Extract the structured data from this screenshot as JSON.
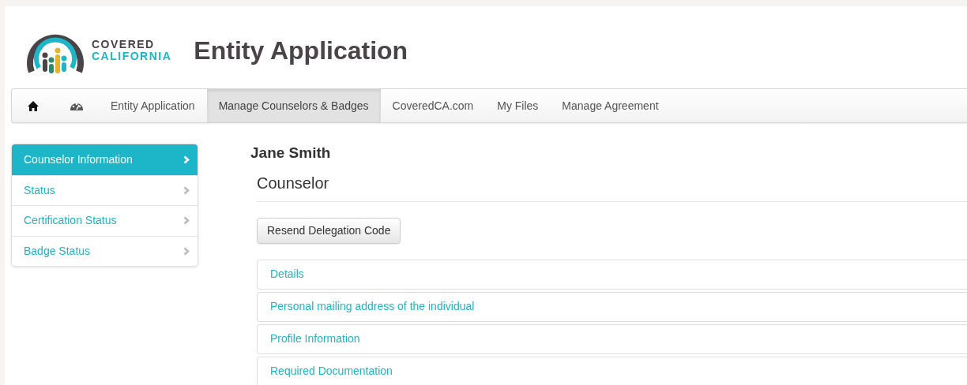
{
  "logo": {
    "line_1": "COVERED",
    "line_2": "CALIFORNIA"
  },
  "page_title": "Entity Application",
  "nav": [
    {
      "kind": "home",
      "selected": false
    },
    {
      "kind": "dashboard",
      "selected": false
    },
    {
      "kind": "text",
      "label": "Entity Application",
      "selected": false
    },
    {
      "kind": "text",
      "label": "Manage Counselors & Badges",
      "selected": true
    },
    {
      "kind": "text",
      "label": "CoveredCA.com",
      "selected": false
    },
    {
      "kind": "text",
      "label": "My Files",
      "selected": false
    },
    {
      "kind": "text",
      "label": "Manage Agreement",
      "selected": false
    }
  ],
  "sidebar": {
    "items": [
      {
        "label": "Counselor Information",
        "selected": true
      },
      {
        "label": "Status",
        "selected": false
      },
      {
        "label": "Certification Status",
        "selected": false
      },
      {
        "label": "Badge Status",
        "selected": false
      }
    ]
  },
  "person_name": "Jane Smith",
  "role": "Counselor",
  "resend_button": "Resend Delegation Code",
  "sections": [
    {
      "title": "Details"
    },
    {
      "title": "Personal mailing address of the individual"
    },
    {
      "title": "Profile Information"
    },
    {
      "title": "Required Documentation"
    }
  ]
}
